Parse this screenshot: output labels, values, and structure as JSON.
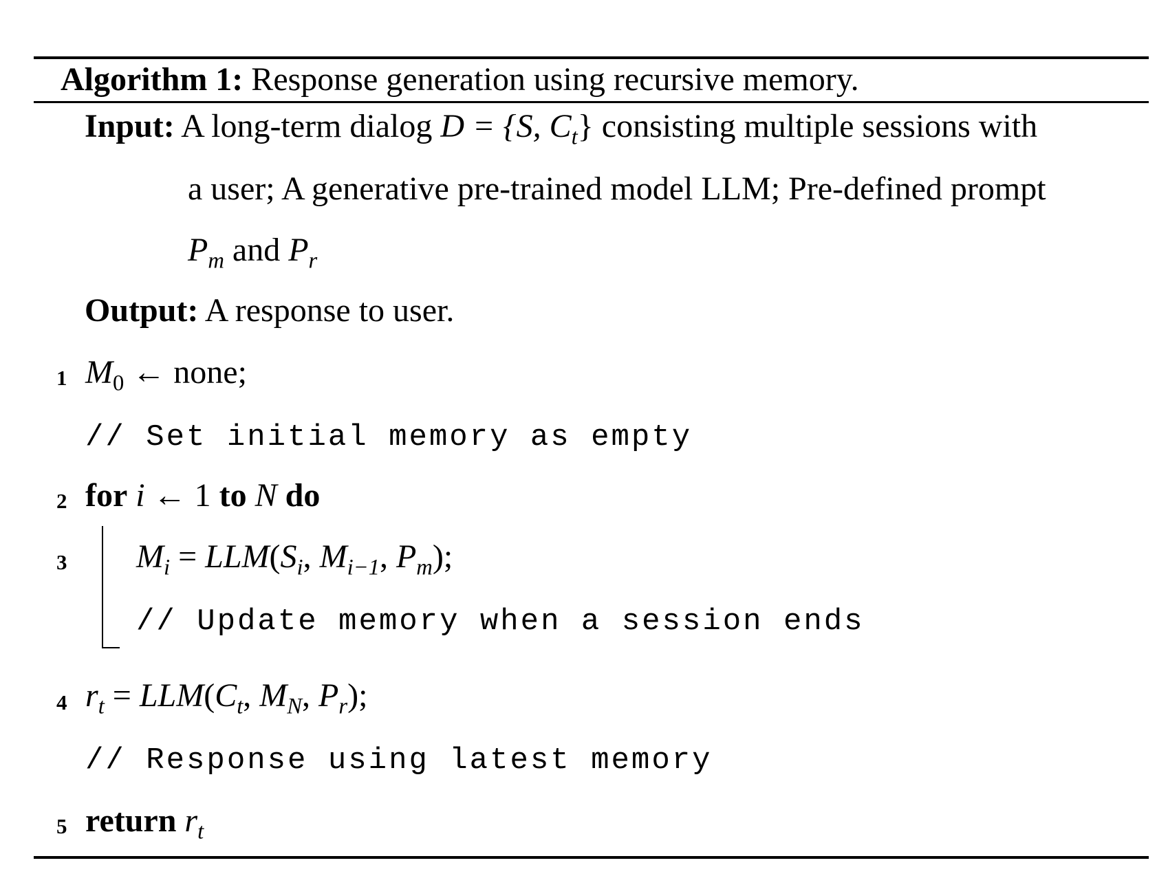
{
  "caption": {
    "label": "Algorithm 1:",
    "text": "Response generation using recursive memory."
  },
  "input": {
    "label": "Input:",
    "line1_pre": "A long-term dialog",
    "line1_math": "D = {S, C",
    "line1_math_sub": "t",
    "line1_math_close": "}",
    "line1_post": "consisting multiple sessions with",
    "line2": "a user; A generative pre-trained model LLM; Pre-defined prompt",
    "line3_p": "P",
    "line3_m": "m",
    "line3_and": "and",
    "line3_p2": "P",
    "line3_r": "r"
  },
  "output": {
    "label": "Output:",
    "text": "A response to user."
  },
  "steps": [
    {
      "num": "1"
    },
    {
      "num": "2"
    },
    {
      "num": "3"
    },
    {
      "num": "4"
    },
    {
      "num": "5"
    }
  ],
  "step1": {
    "var": "M",
    "sub": "0",
    "arrow": "←",
    "value": "none;"
  },
  "comment1": "// Set initial memory as empty",
  "step2": {
    "kw_for": "for",
    "var": "i",
    "arrow": "←",
    "start": "1",
    "kw_to": "to",
    "end": "N",
    "kw_do": "do"
  },
  "step3": {
    "lhs": "M",
    "lhs_sub": "i",
    "eq": "=",
    "fn": "LLM",
    "args": [
      "S",
      "i",
      "M",
      "i−1",
      "P",
      "m"
    ],
    "end": ");"
  },
  "comment2": "// Update memory when a session ends",
  "step4": {
    "lhs": "r",
    "lhs_sub": "t",
    "eq": "=",
    "fn": "LLM",
    "args": [
      "C",
      "t",
      "M",
      "N",
      "P",
      "r"
    ],
    "end": ");"
  },
  "comment3": "// Response using latest memory",
  "step5": {
    "kw": "return",
    "var": "r",
    "sub": "t"
  }
}
